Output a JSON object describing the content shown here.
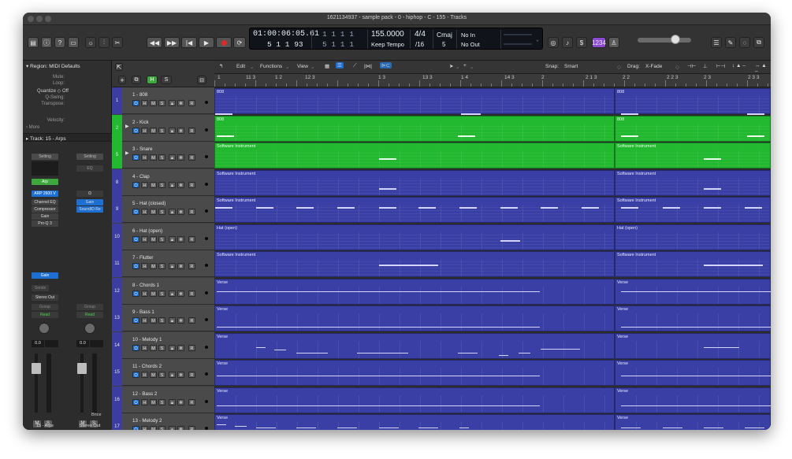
{
  "window": {
    "title": "1621134937 - sample pack - 0 - hiphop - C - 155 - Tracks"
  },
  "lcd": {
    "smpte": "01:00:06:05.61",
    "smpte_sub": "5 1 1 93",
    "bars": "1 1 1 1",
    "bars_sub": "5 1 1 1",
    "tempo": "155.0000",
    "tempo_mode": "Keep Tempo",
    "timesig": "4/4",
    "division": "/16",
    "key": "Cmaj",
    "key_sub": "5",
    "in": "No In",
    "out": "No Out",
    "count": "1234"
  },
  "inspector": {
    "region_header": "Region: MIDI Defaults",
    "mute_label": "Mute:",
    "loop_label": "Loop:",
    "quantize_label": "Quantize",
    "quantize_value": "Off",
    "qswing_label": "Q-Swing:",
    "transpose_label": "Transpose:",
    "velocity_label": "Velocity:",
    "more_label": "More",
    "track_header": "Track:  15 - Arps",
    "setting_left": "Setting",
    "setting_right": "Setting",
    "eq_label": "EQ",
    "arp_label": "Arp",
    "instrument": "ARP 2600 V",
    "plugins_left": [
      "Channel EQ",
      "Compressor",
      "Gain",
      "Pro-Q 3"
    ],
    "plugins_right": [
      "Gain",
      "SoundID Re"
    ],
    "gain_label": "Gain",
    "sends_label": "Sends",
    "output_label": "Stereo Out",
    "group_left": "Group",
    "group_right": "Group",
    "read_left": "Read",
    "read_right": "Read",
    "vol_left": "0.0",
    "vol_right": "0.0",
    "bnce_label": "Bnce",
    "m_label": "M",
    "s_label": "S",
    "strip_name_left": "15 - Arps",
    "strip_name_right": "Stereo Out"
  },
  "toolbar": {
    "edit": "Edit",
    "functions": "Functions",
    "view": "View",
    "snap_label": "Snap:",
    "snap_value": "Smart",
    "drag_label": "Drag:",
    "drag_value": "X-Fade"
  },
  "ruler": {
    "labels": [
      "1",
      "11 3",
      "1 2",
      "12 3",
      "1 3",
      "13 3",
      "1 4",
      "14 3",
      "2",
      "2 1 3",
      "2 2",
      "2 2 3",
      "2 3",
      "2 3 3"
    ]
  },
  "tracks": [
    {
      "num": "1",
      "name": "1 - 808",
      "region1": "808",
      "region2": "808"
    },
    {
      "num": "2",
      "name": "2 - Kick",
      "region1": "808",
      "region2": "808"
    },
    {
      "num": "5",
      "name": "3 - Snare",
      "region1": "Software Instrument",
      "region2": "Software Instrument"
    },
    {
      "num": "8",
      "name": "4 - Clap",
      "region1": "Software Instrument",
      "region2": "Software Instrument"
    },
    {
      "num": "9",
      "name": "5 - Hat (closed)",
      "region1": "Software Instrument",
      "region2": "Software Instrument"
    },
    {
      "num": "10",
      "name": "6 - Hat (open)",
      "region1": "Hat (open)",
      "region2": "Hat (open)"
    },
    {
      "num": "11",
      "name": "7 - Flutter",
      "region1": "Software Instrument",
      "region2": "Software Instrument"
    },
    {
      "num": "12",
      "name": "8 - Chords 1",
      "region1": "Verse",
      "region2": "Verse"
    },
    {
      "num": "13",
      "name": "9 - Bass 1",
      "region1": "Verse",
      "region2": "Verse"
    },
    {
      "num": "14",
      "name": "10 - Melody 1",
      "region1": "Verse",
      "region2": "Verse"
    },
    {
      "num": "15",
      "name": "11 - Chords 2",
      "region1": "Verse",
      "region2": "Verse"
    },
    {
      "num": "16",
      "name": "12 - Bass 2",
      "region1": "Verse",
      "region2": "Verse"
    },
    {
      "num": "17",
      "name": "13 - Melody 2",
      "region1": "Verse",
      "region2": "Verse"
    }
  ],
  "track_buttons": {
    "h": "H",
    "m": "M",
    "s": "S",
    "r": "R"
  },
  "tracklist_header": {
    "h": "H",
    "s": "S"
  },
  "colors": {
    "region_blue": "#393fa4",
    "region_green": "#22b82f",
    "accent_blue": "#1d6fd1",
    "arp_green": "#3ea83e"
  }
}
